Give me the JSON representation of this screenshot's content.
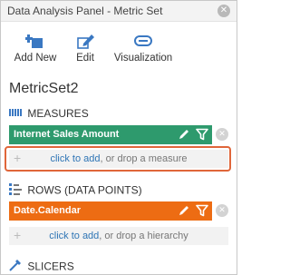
{
  "window": {
    "title": "Data Analysis Panel - Metric Set",
    "close_glyph": "✕"
  },
  "toolbar": {
    "add_new": {
      "label": "Add New",
      "icon": "add-new-icon"
    },
    "edit": {
      "label": "Edit",
      "icon": "pencil-icon"
    },
    "visualization": {
      "label": "Visualization",
      "icon": "visualization-icon"
    }
  },
  "metric_set_name": "MetricSet2",
  "measures": {
    "title": "MEASURES",
    "icon": "measures-icon",
    "items": [
      {
        "label": "Internet Sales Amount",
        "color": "#2e9a6d"
      }
    ],
    "drop": {
      "link": "click to add",
      "rest": ", or drop a measure",
      "plus": "+"
    }
  },
  "rows": {
    "title": "ROWS (DATA POINTS)",
    "icon": "rows-icon",
    "items": [
      {
        "label": "Date.Calendar",
        "color": "#ed6c13"
      }
    ],
    "drop": {
      "link": "click to add",
      "rest": ", or drop a hierarchy",
      "plus": "+"
    }
  },
  "slicers": {
    "title": "SLICERS",
    "icon": "slicers-icon"
  },
  "colors": {
    "accent_link": "#2f75b5",
    "highlight": "#e0663a",
    "icon_blue": "#3a78c2"
  }
}
